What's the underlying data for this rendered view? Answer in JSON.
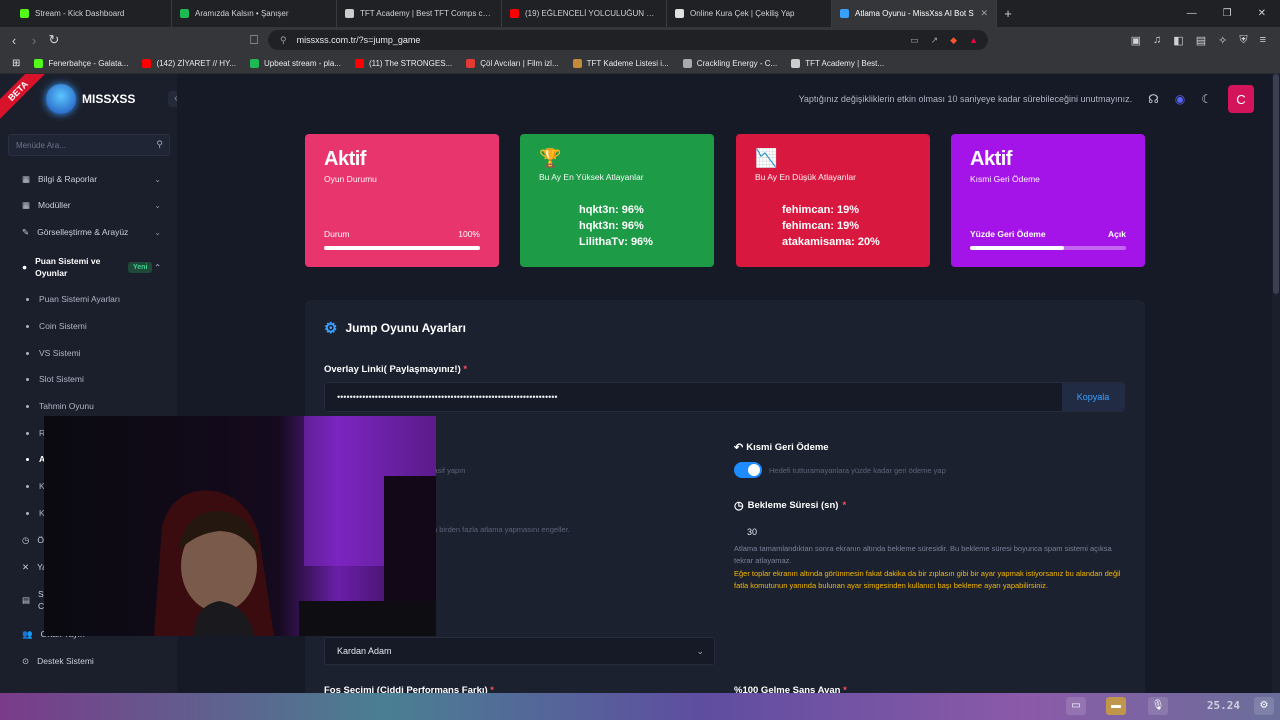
{
  "browser": {
    "tabs": [
      {
        "title": "Stream - Kick Dashboard",
        "color": "#53fc18"
      },
      {
        "title": "Aramızda Kalsın • Şanışer",
        "color": "#1db954"
      },
      {
        "title": "TFT Academy | Best TFT Comps curat",
        "color": "#cccccc"
      },
      {
        "title": "(19) EĞLENCELİ YOLCULUĞUN SONU",
        "color": "#ff0000"
      },
      {
        "title": "Online Kura Çek | Çekiliş Yap",
        "color": "#e0e0e0"
      },
      {
        "title": "Atlama Oyunu - MissXss AI Bot S",
        "color": "#3aa0ff",
        "active": true
      }
    ],
    "new_tab": "+",
    "url": "missxss.com.tr/?s=jump_game",
    "bookmarks": [
      {
        "label": "Fenerbahçe - Galata...",
        "color": "#53fc18"
      },
      {
        "label": "(142) ZİYARET // HY...",
        "color": "#ff0000"
      },
      {
        "label": "Upbeat stream - pla...",
        "color": "#1db954"
      },
      {
        "label": "(11) The STRONGES...",
        "color": "#ff0000"
      },
      {
        "label": "Çöl Avcıları | Film izl...",
        "color": "#e53935"
      },
      {
        "label": "TFT Kademe Listesi i...",
        "color": "#c28a3a"
      },
      {
        "label": "Crackling Energy - C...",
        "color": "#aaaaaa"
      },
      {
        "label": "TFT Academy | Best...",
        "color": "#cccccc"
      }
    ]
  },
  "brand": {
    "name": "MISSXSS",
    "beta": "BETA"
  },
  "sidebar": {
    "search_placeholder": "Menüde Ara...",
    "items": [
      {
        "label": "Bilgi & Raporlar",
        "icon": "dashboard-icon"
      },
      {
        "label": "Modüller",
        "icon": "grid-icon"
      },
      {
        "label": "Görselleştirme & Arayüz",
        "icon": "palette-icon"
      },
      {
        "label": "Puan Sistemi ve Oyunlar",
        "icon": "coins-icon",
        "badge": "Yeni"
      }
    ],
    "subitems": [
      "Puan Sistemi Ayarları",
      "Coin Sistemi",
      "VS Sistemi",
      "Slot Sistemi",
      "Tahmin Oyunu",
      "R",
      "A",
      "K",
      "K"
    ],
    "lower_items": [
      "Ö",
      "Ya",
      "St\nCe",
      "Ortak Yayın",
      "Destek Sistemi"
    ]
  },
  "topbar": {
    "notice": "Yaptığınız değişikliklerin etkin olması 10 saniyeye kadar sürebileceğini unutmayınız.",
    "avatar": "C"
  },
  "cards": [
    {
      "big": "Aktif",
      "label": "Oyun Durumu",
      "bar_label": "Durum",
      "bar_value": "100%",
      "fill": 1.0,
      "color": "#e8356e"
    },
    {
      "icon": "🏆",
      "label": "Bu Ay En Yüksek Atlayanlar",
      "ranks": [
        "hqkt3n: 96%",
        "hqkt3n: 96%",
        "LilithaTv: 96%"
      ],
      "color": "#1e9b47"
    },
    {
      "icon": "📉",
      "label": "Bu Ay En Düşük Atlayanlar",
      "ranks": [
        "fehimcan: 19%",
        "fehimcan: 19%",
        "atakamisama: 20%"
      ],
      "color": "#d9183f"
    },
    {
      "big": "Aktif",
      "label": "Kısmi Geri Ödeme",
      "bar_label": "Yüzde Geri Ödeme",
      "bar_value": "Açık",
      "fill": 0.6,
      "color": "#a414e8"
    }
  ],
  "panel": {
    "title": "Jump Oyunu Ayarları",
    "overlay_label": "Overlay Linki( Paylaşmayınız!)",
    "overlay_value": "••••••••••••••••••••••••••••••••••••••••••••••••••••••••••••••••••••••",
    "copy_label": "Kopyala",
    "partial_title": "Kısmi Geri Ödeme",
    "partial_help": "Hedefi tutturamayanlara yüzde kadar geri ödeme yap",
    "left_faded_1": "f/pasif yapın",
    "left_faded_2": "n birden fazla atlama yapmasını engeller.",
    "wait_title": "Bekleme Süresi (sn)",
    "wait_value": "30",
    "wait_help": "Atlama tamamlandıktan sonra ekranın altında bekleme süresidir. Bu bekleme süresi boyunca spam sistemi açıksa tekrar atlayamaz.",
    "wait_warn": "Eğer toplar ekranın altında görünmesin fakat dakika da bir zıplasın gibi bir ayar yapmak istiyorsanız bu alandan değil fatla komutunun yanında bulunan ayar simgesinden kullanıcı başı bekleme ayarı yapabilirsiniz.",
    "select_value": "Kardan Adam",
    "fos_label": "Fos Seçimi (Ciddi Performans Farkı)",
    "chance_label": "%100 Gelme Şans Avan"
  },
  "taskbar": {
    "clock": "25.24"
  }
}
